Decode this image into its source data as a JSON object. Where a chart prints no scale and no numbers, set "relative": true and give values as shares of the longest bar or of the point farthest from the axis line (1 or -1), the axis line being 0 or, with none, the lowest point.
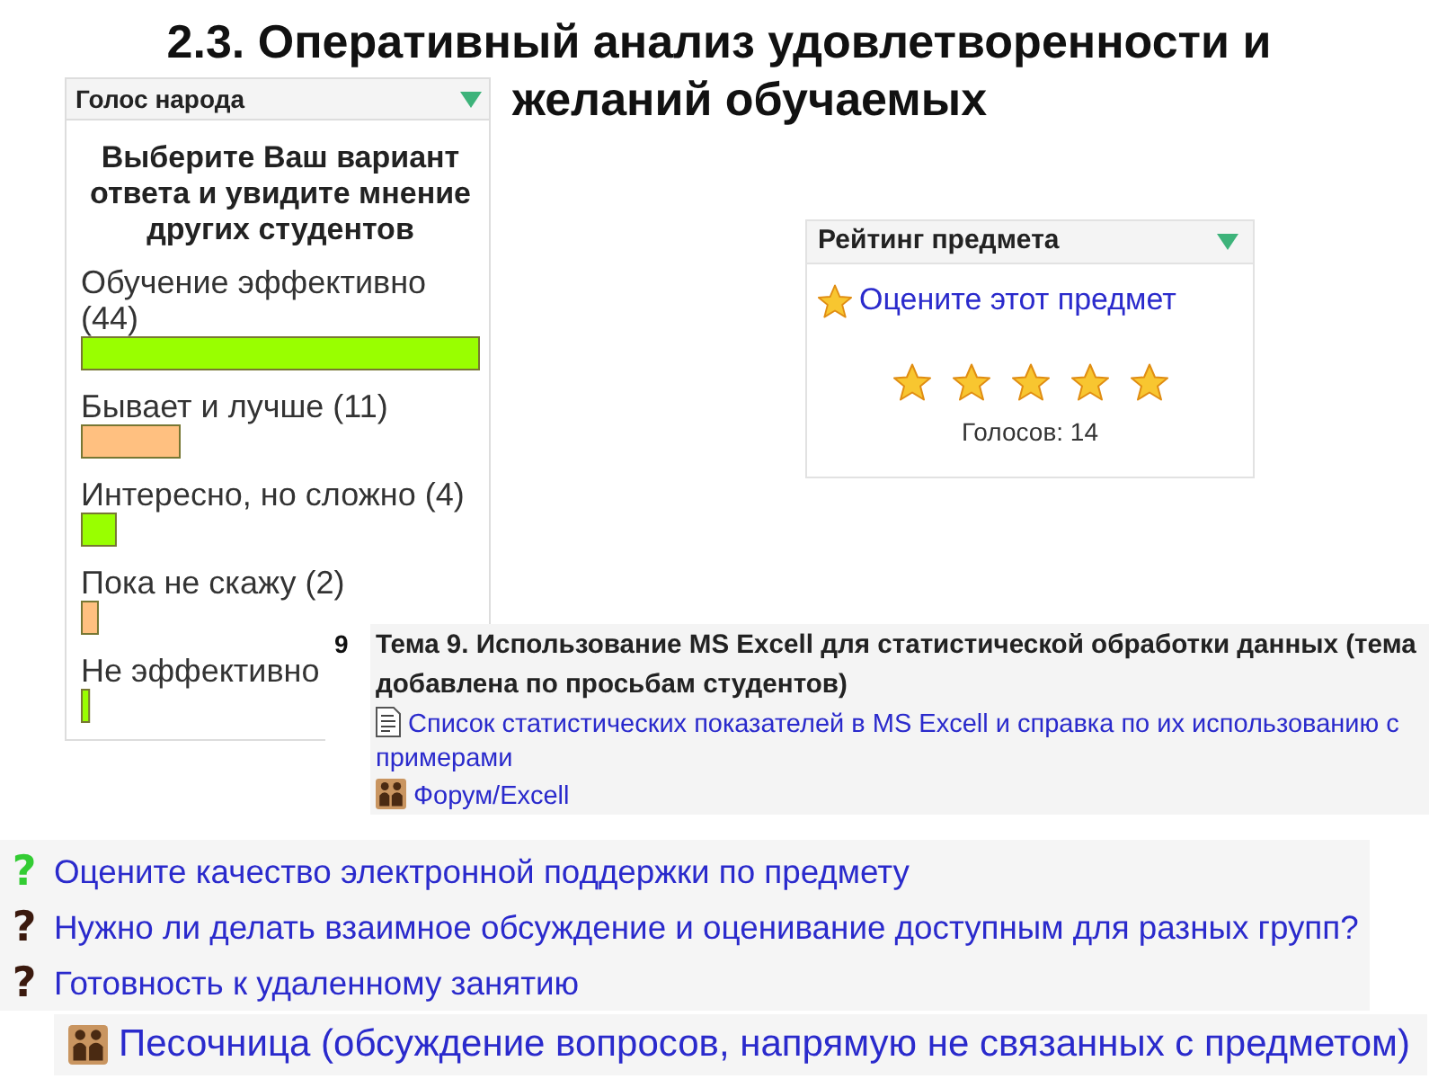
{
  "slide_title": {
    "line_1": "2.3. Оперативный анализ удовлетворенности и",
    "line_2": "желаний обучаемых"
  },
  "poll": {
    "header": "Голос народа",
    "prompt": "Выберите Ваш вариант ответа и увидите мнение других студентов",
    "results": {
      "chart_data": {
        "type": "bar",
        "orientation": "horizontal",
        "relative": true,
        "categories": [
          "Обучение эффективно (44)",
          "Бывает и лучше (11)",
          "Интересно, но сложно (4)",
          "Пока не скажу (2)",
          "Не эффективно"
        ],
        "series": [
          {
            "color": "#99ff00",
            "values": [
              1,
              null,
              0.09,
              null,
              0.023
            ]
          },
          {
            "color": "#ffc080",
            "values": [
              null,
              0.25,
              null,
              0.045,
              null
            ]
          }
        ]
      }
    }
  },
  "rating": {
    "header": "Рейтинг предмета",
    "link": "Оцените этот предмет",
    "stars": 5,
    "votes": "Голосов: 14"
  },
  "topic": {
    "number": "9",
    "title": "Тема 9. Использование MS Excell для статистической обработки данных (тема добавлена по просьбам студентов)",
    "resources": [
      {
        "kind": "document",
        "label": "Список статистических показателей в MS Excell и справка по их использованию с примерами"
      },
      {
        "kind": "forum",
        "label": "Форум/Excell"
      }
    ]
  },
  "activities": [
    {
      "icon": "?",
      "color": "#33cc33",
      "label": "Оцените качество электронной поддержки по предмету"
    },
    {
      "icon": "?",
      "color": "#3b1a0e",
      "label": "Нужно ли делать взаимное обсуждение и оценивание доступным для разных групп?"
    },
    {
      "icon": "?",
      "color": "#3b1a0e",
      "label": "Готовность к удаленному занятию"
    }
  ],
  "sandbox": {
    "kind": "forum",
    "label": "Песочница (обсуждение вопросов, напрямую не связанных с предметом)"
  }
}
